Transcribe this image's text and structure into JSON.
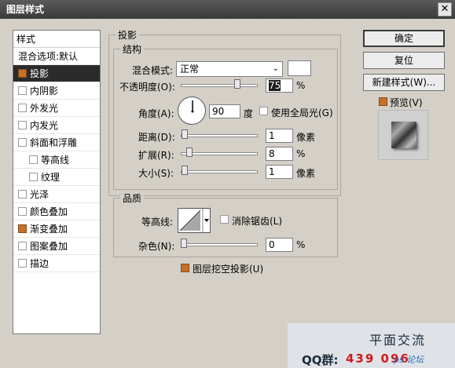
{
  "window": {
    "title": "图层样式",
    "close_glyph": "✕"
  },
  "style_list": {
    "header": "样式",
    "items": [
      {
        "label": "混合选项:默认",
        "checkbox": false,
        "checked": false,
        "sub": false,
        "selected": false
      },
      {
        "label": "投影",
        "checkbox": true,
        "checked": true,
        "sub": false,
        "selected": true
      },
      {
        "label": "内阴影",
        "checkbox": true,
        "checked": false,
        "sub": false,
        "selected": false
      },
      {
        "label": "外发光",
        "checkbox": true,
        "checked": false,
        "sub": false,
        "selected": false
      },
      {
        "label": "内发光",
        "checkbox": true,
        "checked": false,
        "sub": false,
        "selected": false
      },
      {
        "label": "斜面和浮雕",
        "checkbox": true,
        "checked": false,
        "sub": false,
        "selected": false
      },
      {
        "label": "等高线",
        "checkbox": true,
        "checked": false,
        "sub": true,
        "selected": false
      },
      {
        "label": "纹理",
        "checkbox": true,
        "checked": false,
        "sub": true,
        "selected": false
      },
      {
        "label": "光泽",
        "checkbox": true,
        "checked": false,
        "sub": false,
        "selected": false
      },
      {
        "label": "颜色叠加",
        "checkbox": true,
        "checked": false,
        "sub": false,
        "selected": false
      },
      {
        "label": "渐变叠加",
        "checkbox": true,
        "checked": true,
        "sub": false,
        "selected": false
      },
      {
        "label": "图案叠加",
        "checkbox": true,
        "checked": false,
        "sub": false,
        "selected": false
      },
      {
        "label": "描边",
        "checkbox": true,
        "checked": false,
        "sub": false,
        "selected": false
      }
    ]
  },
  "drop_shadow": {
    "section_title": "投影",
    "structure_title": "结构",
    "blend_mode_label": "混合模式:",
    "blend_mode_value": "正常",
    "shadow_color": "#ffffff",
    "opacity_label": "不透明度(O):",
    "opacity_value": "75",
    "opacity_fraction": 0.75,
    "percent": "%",
    "angle_label": "角度(A):",
    "angle_value": "90",
    "angle_unit": "度",
    "global_light_label": "使用全局光(G)",
    "distance_label": "距离(D):",
    "distance_value": "1",
    "distance_fraction": 0.01,
    "px_unit": "像素",
    "spread_label": "扩展(R):",
    "spread_value": "8",
    "spread_fraction": 0.08,
    "size_label": "大小(S):",
    "size_value": "1",
    "size_fraction": 0.01
  },
  "quality": {
    "title": "品质",
    "contour_label": "等高线:",
    "antialias_label": "消除锯齿(L)",
    "noise_label": "杂色(N):",
    "noise_value": "0",
    "noise_fraction": 0.0,
    "knockout_label": "图层挖空投影(U)"
  },
  "buttons": {
    "ok": "确定",
    "reset": "复位",
    "new_style": "新建样式(W)...",
    "preview_label": "预览(V)"
  },
  "watermark": {
    "title": "平面交流",
    "qq_label": "QQ群:",
    "qq_number": "439 096",
    "logo_text": "ps 论坛"
  },
  "colors": {
    "accent_checkbox": "#c4712a",
    "selected_row": "#2b2b2b",
    "titlebar": "#404040"
  }
}
